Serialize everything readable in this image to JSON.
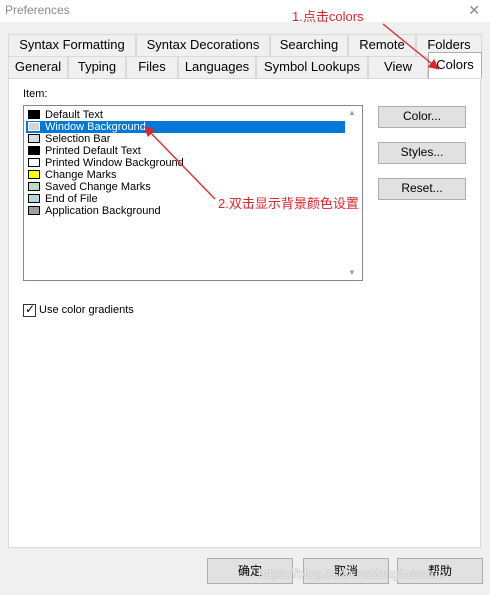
{
  "window": {
    "title": "Preferences"
  },
  "tabs_row1": [
    "Syntax Formatting",
    "Syntax Decorations",
    "Searching",
    "Remote",
    "Folders"
  ],
  "tabs_row2": [
    "General",
    "Typing",
    "Files",
    "Languages",
    "Symbol Lookups",
    "View"
  ],
  "active_tab": "Colors",
  "panel": {
    "item_label": "Item:",
    "items": [
      {
        "label": "Default Text",
        "color": "#000000"
      },
      {
        "label": "Window Background",
        "color": "#d3d3d3",
        "selected": true
      },
      {
        "label": "Selection Bar",
        "color": "#dcdcdc"
      },
      {
        "label": "Printed Default Text",
        "color": "#000000"
      },
      {
        "label": "Printed Window Background",
        "color": "#ffffff"
      },
      {
        "label": "Change Marks",
        "color": "#ffff00"
      },
      {
        "label": "Saved Change Marks",
        "color": "#c0dcc0"
      },
      {
        "label": "End of File",
        "color": "#b8d8e0"
      },
      {
        "label": "Application Background",
        "color": "#a0a0a0"
      }
    ],
    "buttons": {
      "color": "Color...",
      "styles": "Styles...",
      "reset": "Reset..."
    },
    "gradient_checkbox": {
      "label": "Use color gradients",
      "checked": true
    }
  },
  "footer": {
    "ok": "确定",
    "cancel": "取消",
    "help": "帮助"
  },
  "annotations": {
    "step1": "1.点击colors",
    "step2": "2.双击显示背景颜色设置"
  },
  "watermark": "https://blog.csdn.net/engineerxin",
  "colors": {
    "annotation": "#e0262d",
    "selection": "#0078d7"
  }
}
